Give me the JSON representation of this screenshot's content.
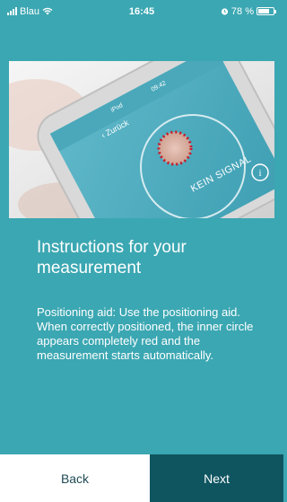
{
  "status_bar": {
    "carrier": "Blau",
    "time": "16:45",
    "battery_percent": "78 %",
    "battery_level": 0.78
  },
  "hero": {
    "phone_time": "09:42",
    "phone_carrier": "iPod",
    "phone_back_label": "Zurück",
    "phone_signal_text": "KEIN SIGNAL",
    "phone_info_glyph": "i"
  },
  "instructions": {
    "title": "Instructions for your measurement",
    "body": "Positioning aid: Use the positioning aid. When correctly positioned, the inner circle appears completely red and the measurement starts automatically."
  },
  "navigation": {
    "back_label": "Back",
    "next_label": "Next"
  },
  "colors": {
    "teal_background": "#3ba7b2",
    "dark_teal_button": "#0e5560",
    "white": "#ffffff",
    "indicator_red": "#c7192b"
  }
}
